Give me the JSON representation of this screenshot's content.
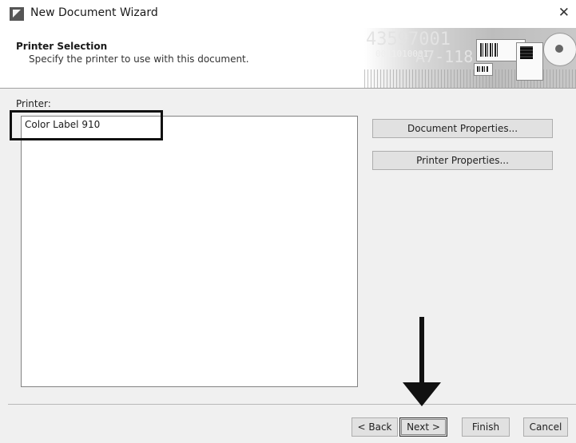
{
  "window": {
    "title": "New Document Wizard",
    "close_glyph": "✕"
  },
  "header": {
    "title": "Printer Selection",
    "subtitle": "Specify the printer to use with this document.",
    "banner": {
      "big_number": "43597001",
      "small_number": "A7-118",
      "tiny_text": "0011010001"
    }
  },
  "printer": {
    "label": "Printer:",
    "items": [
      "Color Label 910"
    ],
    "selected": "Color Label 910"
  },
  "buttons": {
    "document_properties": "Document Properties...",
    "printer_properties": "Printer Properties...",
    "back": "< Back",
    "next": "Next >",
    "finish": "Finish",
    "cancel": "Cancel"
  },
  "annotations": {
    "highlight_target": "printer-list-item",
    "arrow_target": "next-button",
    "color": "#111111"
  }
}
